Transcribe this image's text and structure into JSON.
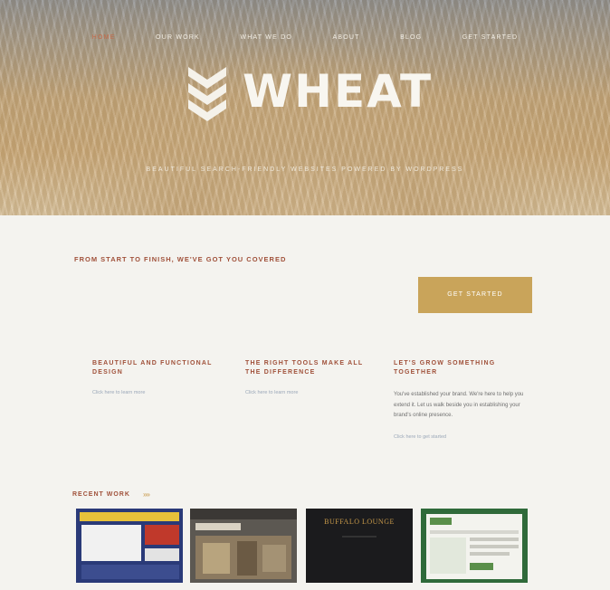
{
  "nav": {
    "items": [
      {
        "label": "Home",
        "active": true
      },
      {
        "label": "Our Work",
        "active": false
      },
      {
        "label": "What We Do",
        "active": false
      },
      {
        "label": "About",
        "active": false
      },
      {
        "label": "Blog",
        "active": false
      },
      {
        "label": "Get Started",
        "active": false
      }
    ]
  },
  "hero": {
    "logo_text": "WHEAT",
    "tagline": "Beautiful Search-Friendly Websites Powered by WordPress"
  },
  "intro": {
    "heading": "FROM START TO FINISH, WE'VE GOT YOU COVERED",
    "cta_label": "GET STARTED"
  },
  "columns": [
    {
      "heading": "BEAUTIFUL AND FUNCTIONAL DESIGN",
      "link": "Click here to learn more"
    },
    {
      "heading": "THE RIGHT TOOLS MAKE ALL THE DIFFERENCE",
      "link": "Click here to learn more"
    },
    {
      "heading": "LET'S GROW SOMETHING TOGETHER",
      "body": "You've established your brand. We're here to help you extend it. Let us walk beside you in establishing your brand's online presence.",
      "link": "Click here to get started"
    }
  ],
  "recent_work": {
    "heading": "RECENT WORK",
    "arrows": "»»",
    "thumbs": [
      {
        "label": ""
      },
      {
        "label": ""
      },
      {
        "label": "BUFFALO LOUNGE"
      },
      {
        "label": ""
      }
    ]
  },
  "colors": {
    "accent_red": "#a0513a",
    "cta_gold": "#c9a45a",
    "body_text": "#8a8a8a"
  }
}
